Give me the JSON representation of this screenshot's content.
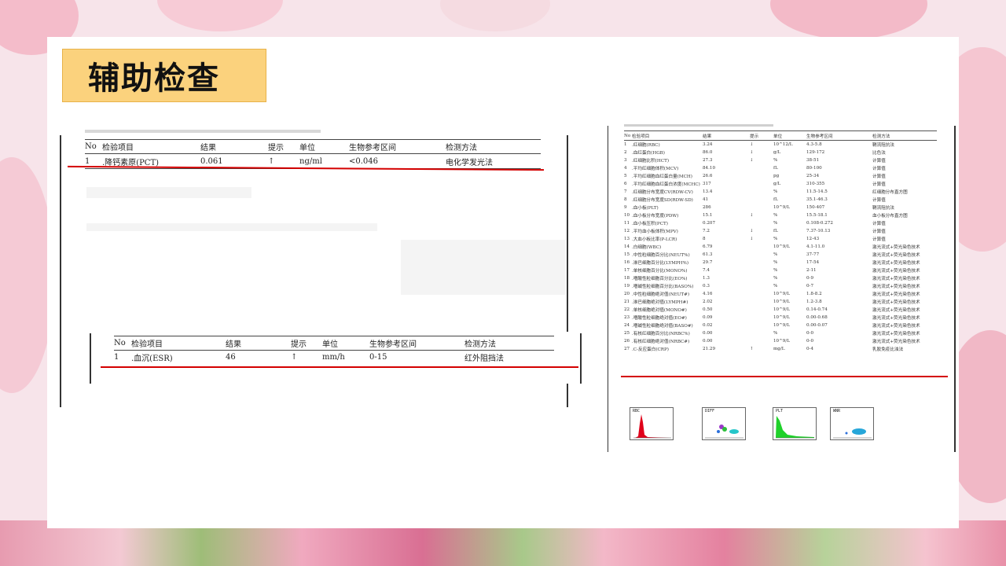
{
  "slide": {
    "title": "辅助检查"
  },
  "pct_report": {
    "headers": [
      "No",
      "检验项目",
      "结果",
      "提示",
      "单位",
      "生物参考区间",
      "检测方法"
    ],
    "rows": [
      [
        "1",
        ".降钙素原(PCT)",
        "0.061",
        "↑",
        "ng/ml",
        "<0.046",
        "电化学发光法"
      ]
    ]
  },
  "esr_report": {
    "headers": [
      "No",
      "检验项目",
      "结果",
      "提示",
      "单位",
      "生物参考区间",
      "检测方法"
    ],
    "rows": [
      [
        "1",
        ".血沉(ESR)",
        "46",
        "↑",
        "mm/h",
        "0-15",
        "红外阻挡法"
      ]
    ]
  },
  "cbc_report": {
    "headers": [
      "No",
      "检验项目",
      "结果",
      "提示",
      "单位",
      "生物参考区间",
      "检测方法"
    ],
    "rows": [
      [
        "1",
        ".红细胞(RBC)",
        "3.24",
        "↓",
        "10^12/L",
        "4.3-5.8",
        "鞘流阻抗法"
      ],
      [
        "2",
        ".血红蛋白(HGB)",
        "86.0",
        "↓",
        "g/L",
        "129-172",
        "比色法"
      ],
      [
        "3",
        ".红细胞比积(HCT)",
        "27.3",
        "↓",
        "%",
        "38-51",
        "计算值"
      ],
      [
        "4",
        ".平均红细胞体积(MCV)",
        "84.10",
        "",
        "fL",
        "80-100",
        "计算值"
      ],
      [
        "5",
        ".平均红细胞血红蛋白量(MCH)",
        "26.6",
        "",
        "pg",
        "25-34",
        "计算值"
      ],
      [
        "6",
        ".平均红细胞血红蛋白浓度(MCHC)",
        "317",
        "",
        "g/L",
        "310-355",
        "计算值"
      ],
      [
        "7",
        ".红细胞分布宽度CV(RDW-CV)",
        "13.4",
        "",
        "%",
        "11.5-14.5",
        "红细胞分布直方图"
      ],
      [
        "8",
        ".红细胞分布宽度SD(RDW-SD)",
        "41",
        "",
        "fL",
        "35.1-46.3",
        "计算值"
      ],
      [
        "9",
        ".血小板(PLT)",
        "286",
        "",
        "10^9/L",
        "150-407",
        "鞘流阻抗法"
      ],
      [
        "10",
        ".血小板分布宽度(PDW)",
        "15.1",
        "↓",
        "%",
        "15.5-18.1",
        "血小板分布直方图"
      ],
      [
        "11",
        ".血小板压积(PCT)",
        "0.207",
        "",
        "%",
        "0.108-0.272",
        "计算值"
      ],
      [
        "12",
        ".平均血小板体积(MPV)",
        "7.2",
        "↓",
        "fL",
        "7.37-10.13",
        "计算值"
      ],
      [
        "13",
        ".大血小板比率(P-LCR)",
        "8",
        "↓",
        "%",
        "12-43",
        "计算值"
      ],
      [
        "14",
        ".白细胞(WBC)",
        "6.79",
        "",
        "10^9/L",
        "4.1-11.0",
        "激光流式+荧光染色技术"
      ],
      [
        "15",
        ".中性粒细胞百分比(NEUT%)",
        "61.3",
        "",
        "%",
        "37-77",
        "激光流式+荧光染色技术"
      ],
      [
        "16",
        ".淋巴细胞百分比(LYMPH%)",
        "29.7",
        "",
        "%",
        "17-54",
        "激光流式+荧光染色技术"
      ],
      [
        "17",
        ".单核细胞百分比(MONO%)",
        "7.4",
        "",
        "%",
        "2-11",
        "激光流式+荧光染色技术"
      ],
      [
        "18",
        ".嗜酸性粒细胞百分比(EO%)",
        "1.3",
        "",
        "%",
        "0-9",
        "激光流式+荧光染色技术"
      ],
      [
        "19",
        ".嗜碱性粒细胞百分比(BASO%)",
        "0.3",
        "",
        "%",
        "0-7",
        "激光流式+荧光染色技术"
      ],
      [
        "20",
        ".中性粒细胞绝对值(NEUT#)",
        "4.16",
        "",
        "10^9/L",
        "1.8-8.2",
        "激光流式+荧光染色技术"
      ],
      [
        "21",
        ".淋巴细胞绝对值(LYMPH#)",
        "2.02",
        "",
        "10^9/L",
        "1.2-3.8",
        "激光流式+荧光染色技术"
      ],
      [
        "22",
        ".单核细胞绝对值(MONO#)",
        "0.50",
        "",
        "10^9/L",
        "0.14-0.74",
        "激光流式+荧光染色技术"
      ],
      [
        "23",
        ".嗜酸性粒细胞绝对值(EO#)",
        "0.09",
        "",
        "10^9/L",
        "0.00-0.68",
        "激光流式+荧光染色技术"
      ],
      [
        "24",
        ".嗜碱性粒细胞绝对值(BASO#)",
        "0.02",
        "",
        "10^9/L",
        "0.00-0.07",
        "激光流式+荧光染色技术"
      ],
      [
        "25",
        ".有核红细胞百分比(NRBC%)",
        "0.00",
        "",
        "%",
        "0-0",
        "激光流式+荧光染色技术"
      ],
      [
        "26",
        ".有核红细胞绝对值(NRBC#)",
        "0.00",
        "",
        "10^9/L",
        "0-0",
        "激光流式+荧光染色技术"
      ],
      [
        "27",
        ".C-反应蛋白(CRP)",
        "21.29",
        "↑",
        "mg/L",
        "0-4",
        "乳胶免疫比浊法"
      ]
    ]
  },
  "histograms": [
    "RBC",
    "DIFF",
    "PLT",
    "WNR"
  ],
  "colors": {
    "title_bg": "#fbd27d",
    "red_line": "#d40000",
    "rbc": "#e0001a",
    "plt": "#1fd12a",
    "diff": "#26c6c9"
  }
}
